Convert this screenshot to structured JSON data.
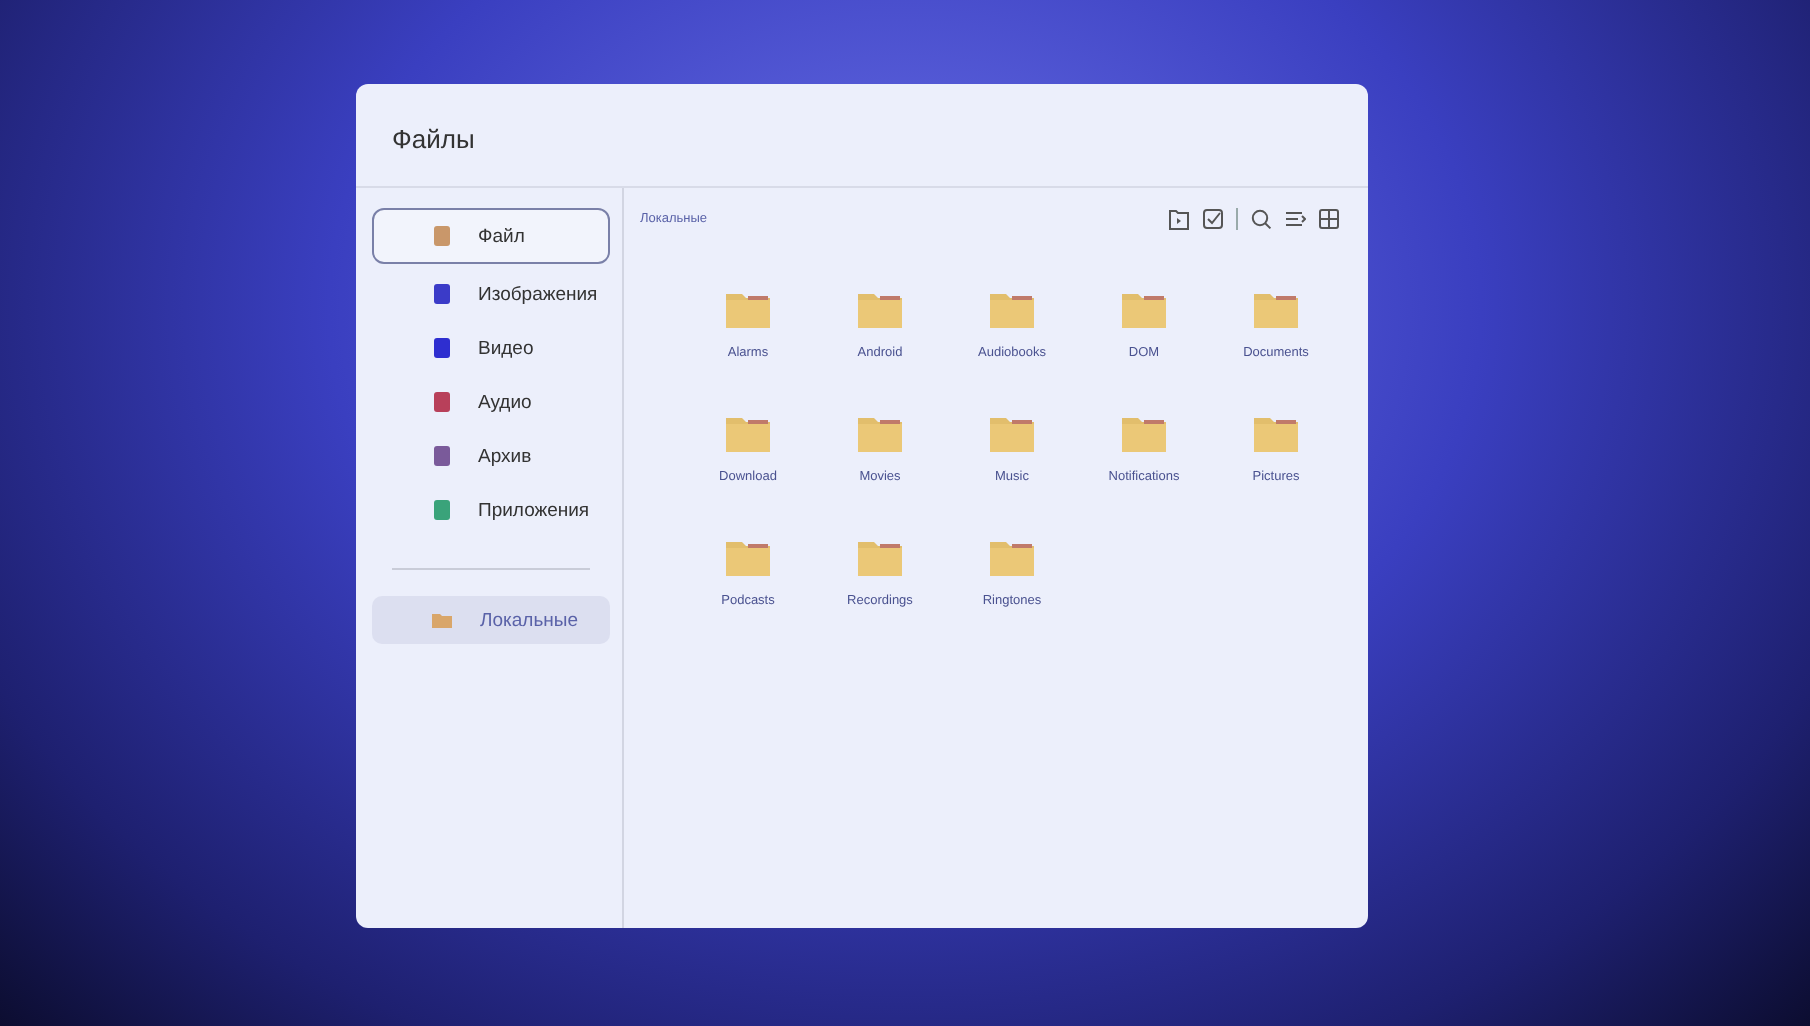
{
  "window": {
    "title": "Файлы"
  },
  "sidebar": {
    "categories": [
      {
        "label": "Файл",
        "color": "#c9976a",
        "selected": true
      },
      {
        "label": "Изображения",
        "color": "#3b3bc8",
        "selected": false
      },
      {
        "label": "Видео",
        "color": "#2e2ed0",
        "selected": false
      },
      {
        "label": "Аудио",
        "color": "#b8405a",
        "selected": false
      },
      {
        "label": "Архив",
        "color": "#7a5a9a",
        "selected": false
      },
      {
        "label": "Приложения",
        "color": "#3aa37a",
        "selected": false
      }
    ],
    "locations": [
      {
        "label": "Локальные",
        "selected": true
      }
    ]
  },
  "breadcrumb": "Локальные",
  "folders": [
    {
      "name": "Alarms"
    },
    {
      "name": "Android"
    },
    {
      "name": "Audiobooks"
    },
    {
      "name": "DOM"
    },
    {
      "name": "Documents"
    },
    {
      "name": "Download"
    },
    {
      "name": "Movies"
    },
    {
      "name": "Music"
    },
    {
      "name": "Notifications"
    },
    {
      "name": "Pictures"
    },
    {
      "name": "Podcasts"
    },
    {
      "name": "Recordings"
    },
    {
      "name": "Ringtones"
    }
  ]
}
